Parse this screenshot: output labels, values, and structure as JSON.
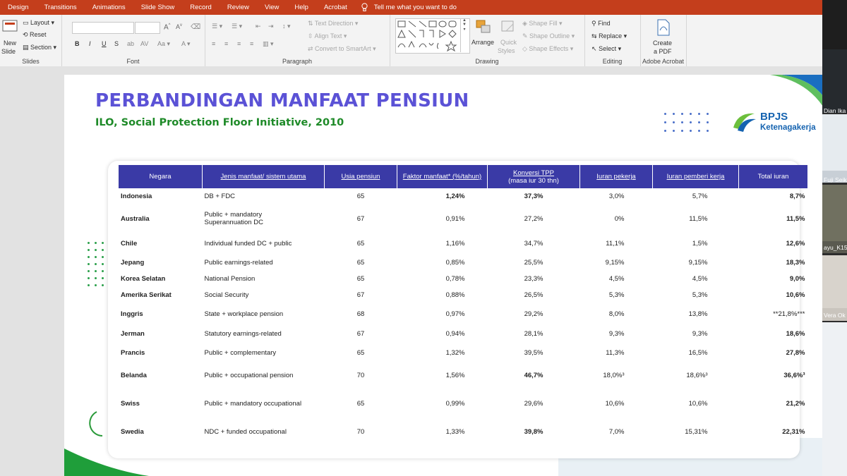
{
  "menu": {
    "tabs": [
      "Design",
      "Transitions",
      "Animations",
      "Slide Show",
      "Record",
      "Review",
      "View",
      "Help",
      "Acrobat"
    ],
    "tell_me": "Tell me what you want to do"
  },
  "ribbon": {
    "slides": {
      "new_slide": "New",
      "new_slide2": "Slide",
      "layout": "Layout",
      "reset": "Reset",
      "section": "Section",
      "label": "Slides"
    },
    "font": {
      "bold": "B",
      "italic": "I",
      "underline": "U",
      "strike": "S",
      "aa": "A",
      "label": "Font"
    },
    "paragraph": {
      "text_direction": "Text Direction",
      "align_text": "Align Text",
      "convert": "Convert to SmartArt",
      "label": "Paragraph"
    },
    "drawing": {
      "arrange": "Arrange",
      "quick_styles": "Quick",
      "quick_styles2": "Styles",
      "shape_fill": "Shape Fill",
      "shape_outline": "Shape Outline",
      "shape_effects": "Shape Effects",
      "label": "Drawing"
    },
    "editing": {
      "find": "Find",
      "replace": "Replace",
      "select": "Select",
      "label": "Editing"
    },
    "acrobat": {
      "create": "Create",
      "create2": "a PDF",
      "label": "Adobe Acrobat"
    }
  },
  "slide": {
    "title": "PERBANDINGAN MANFAAT PENSIUN",
    "subtitle": "ILO, Social Protection Floor Initiative, 2010",
    "logo_line1": "BPJS",
    "logo_line2": "Ketenagakerja"
  },
  "table": {
    "headers": [
      "Negara",
      "Jenis manfaat/ sistem utama",
      "Usia pensiun",
      "Faktor manfaat* (%/tahun)",
      "Konversi TPP",
      "(masa iur 30 thn)",
      "Iuran pekerja",
      "Iuran pemberi kerja",
      "Total iuran"
    ],
    "rows": [
      [
        "Indonesia",
        "DB + FDC",
        "65",
        "1,24%",
        "37,3%",
        "3,0%",
        "5,7%",
        "8,7%"
      ],
      [
        "Australia",
        "Public + mandatory",
        "67",
        "0,91%",
        "27,2%",
        "0%",
        "11,5%",
        "11,5%"
      ],
      [
        "Chile",
        "Individual funded DC + public",
        "65",
        "1,16%",
        "34,7%",
        "11,1%",
        "1,5%",
        "12,6%"
      ],
      [
        "Jepang",
        "Public earnings-related",
        "65",
        "0,85%",
        "25,5%",
        "9,15%",
        "9,15%",
        "18,3%"
      ],
      [
        "Korea Selatan",
        "National Pension",
        "65",
        "0,78%",
        "23,3%",
        "4,5%",
        "4,5%",
        "9,0%"
      ],
      [
        "Amerika Serikat",
        "Social Security",
        "67",
        "0,88%",
        "26,5%",
        "5,3%",
        "5,3%",
        "10,6%"
      ],
      [
        "Inggris",
        "State + workplace pension",
        "68",
        "0,97%",
        "29,2%",
        "8,0%",
        "13,8%",
        "**21,8%***"
      ],
      [
        "Jerman",
        "Statutory earnings-related",
        "67",
        "0,94%",
        "28,1%",
        "9,3%",
        "9,3%",
        "18,6%"
      ],
      [
        "Prancis",
        "Public + complementary",
        "65",
        "1,32%",
        "39,5%",
        "11,3%",
        "16,5%",
        "27,8%"
      ],
      [
        "Belanda",
        "Public + occupational pension",
        "70",
        "1,56%",
        "46,7%",
        "18,0%³",
        "18,6%³",
        "36,6%³"
      ],
      [
        "Swiss",
        "Public + mandatory occupational",
        "65",
        "0,99%",
        "29,6%",
        "10,6%",
        "10,6%",
        "21,2%"
      ],
      [
        "Swedia",
        "NDC + funded occupational",
        "70",
        "1,33%",
        "39,8%",
        "7,0%",
        "15,31%",
        "22,31%"
      ]
    ],
    "australia_line2": "Superannuation DC"
  },
  "participants": [
    {
      "name": "Dian Ika"
    },
    {
      "name": "Fuji Seik"
    },
    {
      "name": "ayu_K15"
    },
    {
      "name": "Vera Ok"
    }
  ],
  "colors": {
    "menubar": "#c43e1c",
    "title": "#5b52d6",
    "subtitle": "#1e8a28",
    "table_header": "#3a3aa6",
    "logo": "#1563b0"
  }
}
